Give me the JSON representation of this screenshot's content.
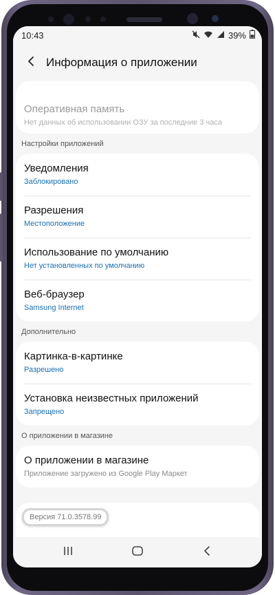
{
  "status": {
    "time": "10:43",
    "battery": "39%"
  },
  "appbar": {
    "title": "Информация о приложении"
  },
  "memory": {
    "title": "Оперативная память",
    "subtitle": "Нет данных об использовании ОЗУ за последние 3 часа"
  },
  "sections": {
    "app_settings": "Настройки приложений",
    "advanced": "Дополнительно",
    "store": "О приложении в магазине"
  },
  "app_settings_items": [
    {
      "title": "Уведомления",
      "subtitle": "Заблокировано"
    },
    {
      "title": "Разрешения",
      "subtitle": "Местоположение"
    },
    {
      "title": "Использование по умолчанию",
      "subtitle": "Нет установленных по умолчанию"
    },
    {
      "title": "Веб-браузер",
      "subtitle": "Samsung Internet"
    }
  ],
  "advanced_items": [
    {
      "title": "Картинка-в-картинке",
      "subtitle": "Разрешено"
    },
    {
      "title": "Установка неизвестных приложений",
      "subtitle": "Запрещено"
    }
  ],
  "store_item": {
    "title": "О приложении в магазине",
    "subtitle": "Приложение загружено из Google Play Маркет"
  },
  "version": "Версия 71.0.3578.99",
  "icons": {
    "back": "back-arrow-icon",
    "mute": "mute-icon",
    "wifi": "wifi-icon",
    "signal": "signal-icon",
    "battery": "battery-icon",
    "recents": "recents-icon",
    "home": "home-icon",
    "nav_back": "nav-back-icon"
  },
  "colors": {
    "accent_link": "#1a6fb3",
    "phone_frame": "#5c546f",
    "screen_bg": "#f5f5f5"
  }
}
